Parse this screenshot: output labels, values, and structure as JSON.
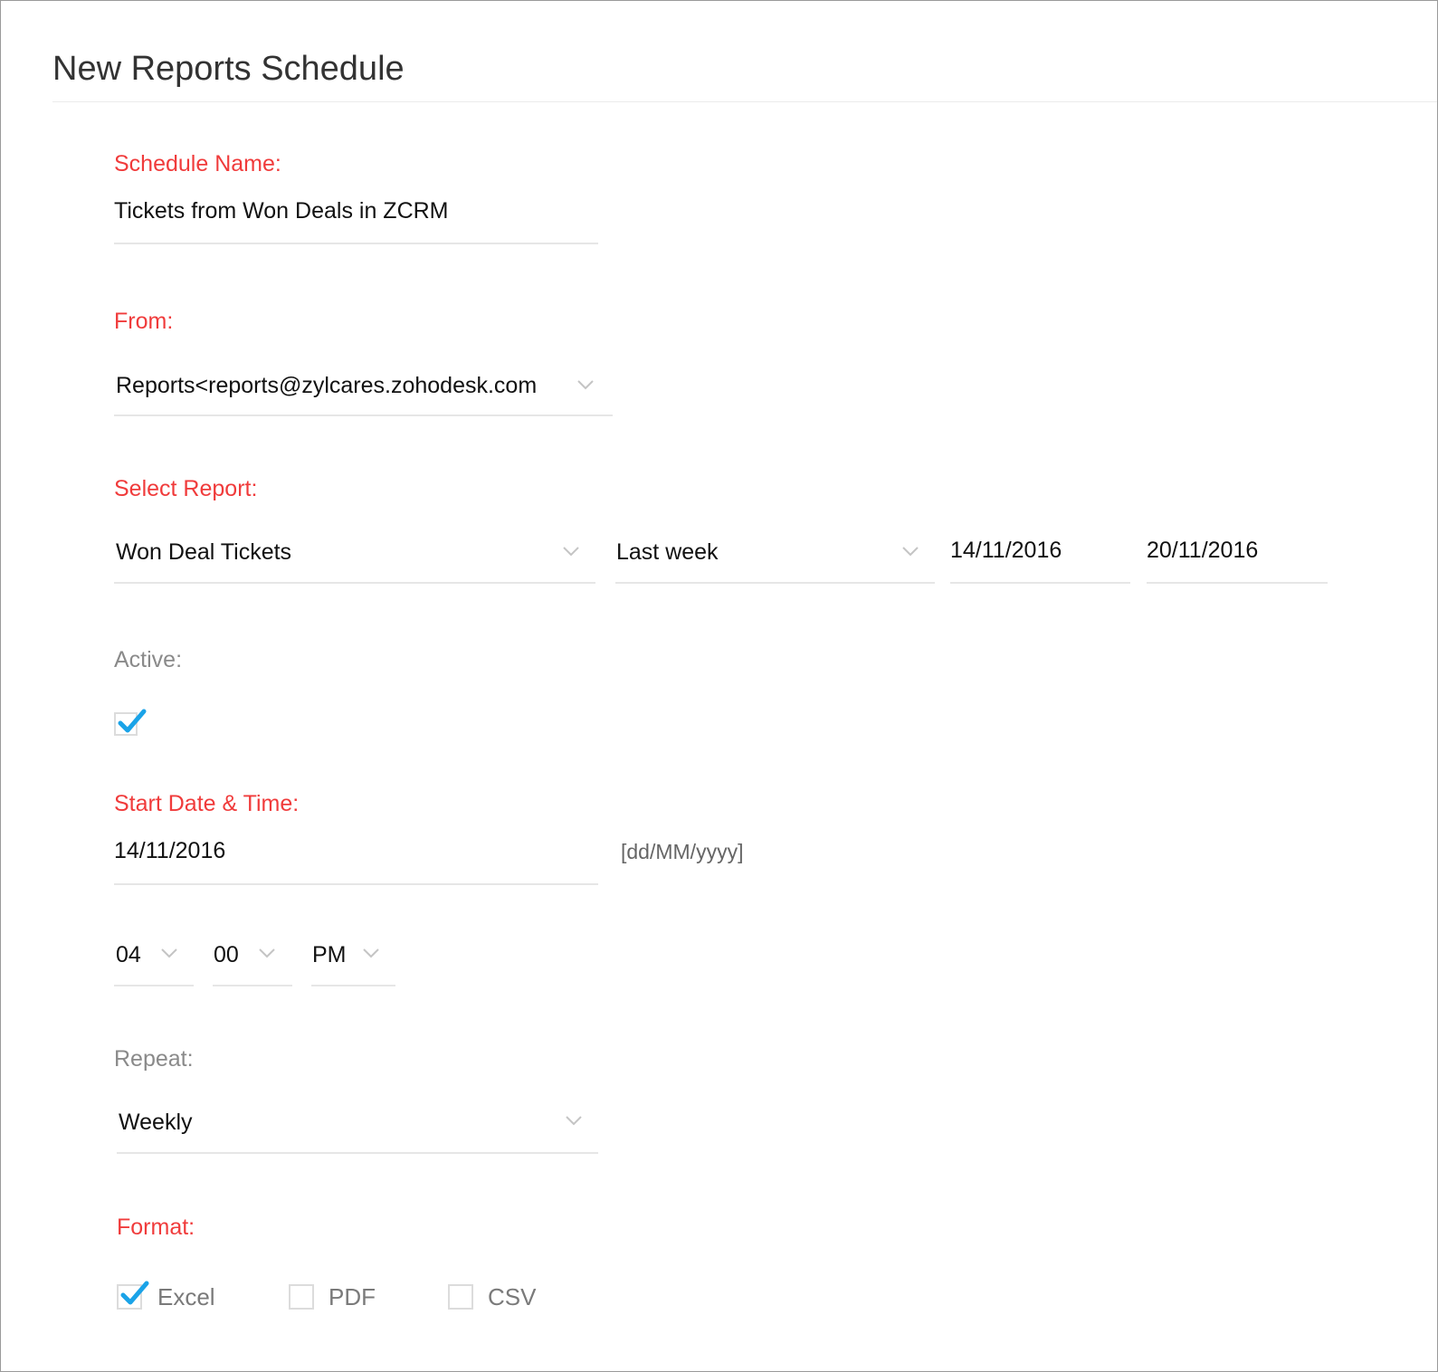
{
  "page": {
    "title": "New Reports Schedule"
  },
  "schedule_name": {
    "label": "Schedule Name:",
    "value": "Tickets from Won Deals in ZCRM"
  },
  "from": {
    "label": "From:",
    "value": "Reports<reports@zylcares.zohodesk.com"
  },
  "select_report": {
    "label": "Select Report:",
    "report": "Won Deal Tickets",
    "period": "Last week",
    "start_date": "14/11/2016",
    "end_date": "20/11/2016"
  },
  "active": {
    "label": "Active:",
    "checked": true
  },
  "start": {
    "label": "Start Date & Time:",
    "date": "14/11/2016",
    "date_format_hint": "[dd/MM/yyyy]",
    "hour": "04",
    "minute": "00",
    "ampm": "PM"
  },
  "repeat": {
    "label": "Repeat:",
    "value": "Weekly"
  },
  "format": {
    "label": "Format:",
    "options": [
      {
        "label": "Excel",
        "checked": true
      },
      {
        "label": "PDF",
        "checked": false
      },
      {
        "label": "CSV",
        "checked": false
      }
    ]
  },
  "colors": {
    "required_label": "#f03b3b",
    "check_accent": "#1aa3e8",
    "underline": "#e6e6e6"
  },
  "icons": {
    "dropdown": "chevron-down-icon",
    "check": "checkmark-icon"
  }
}
